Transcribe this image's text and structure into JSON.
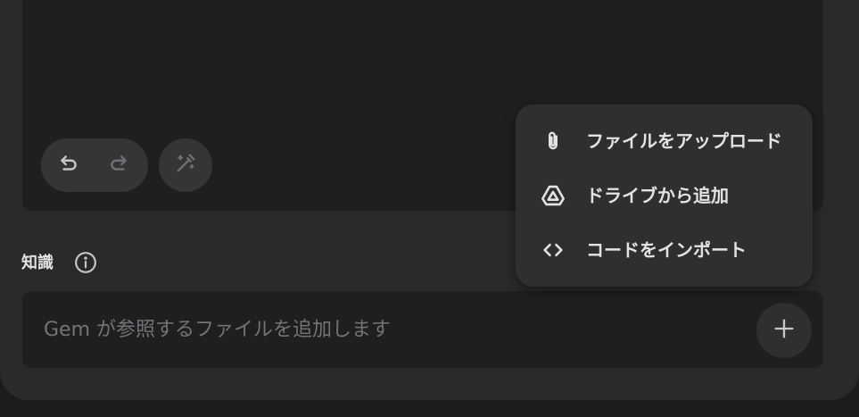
{
  "editor": {
    "undo_icon": "undo-icon",
    "redo_icon": "redo-icon",
    "magic_icon": "magic-pen-icon"
  },
  "knowledge": {
    "label": "知識",
    "info_icon": "info-icon",
    "placeholder": "Gem が参照するファイルを追加します",
    "add_icon": "plus-icon"
  },
  "add_menu": {
    "items": [
      {
        "label": "ファイルをアップロード",
        "icon": "paperclip-icon"
      },
      {
        "label": "ドライブから追加",
        "icon": "drive-icon"
      },
      {
        "label": "コードをインポート",
        "icon": "code-icon"
      }
    ]
  },
  "colors": {
    "background": "#1b1c1d",
    "panel": "#282a2c",
    "surface": "#1e1f20",
    "menu": "#2d2f31",
    "text": "#e3e3e3",
    "muted": "#727477"
  }
}
